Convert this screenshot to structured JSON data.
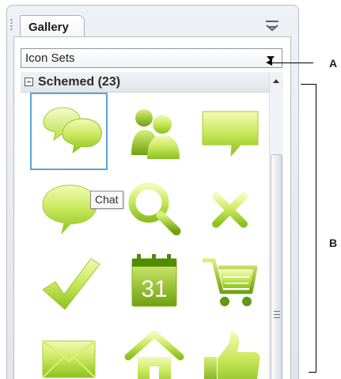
{
  "panel": {
    "tab_label": "Gallery",
    "menu_icon": "panel-menu-icon"
  },
  "dropdown": {
    "selected": "Icon Sets"
  },
  "group": {
    "title": "Schemed (23)",
    "collapse_icon": "collapse-minus-icon"
  },
  "gallery": {
    "items": [
      {
        "icon": "chat-icon",
        "selected": true
      },
      {
        "icon": "users-icon",
        "selected": false
      },
      {
        "icon": "speech-rectangle-icon",
        "selected": false
      },
      {
        "icon": "comment-bubble-icon",
        "selected": false
      },
      {
        "icon": "search-icon",
        "selected": false
      },
      {
        "icon": "close-x-icon",
        "selected": false
      },
      {
        "icon": "check-icon",
        "selected": false
      },
      {
        "icon": "calendar-icon",
        "calendar_day": "31",
        "selected": false
      },
      {
        "icon": "shopping-cart-icon",
        "selected": false
      },
      {
        "icon": "mail-icon",
        "selected": false
      },
      {
        "icon": "home-icon",
        "selected": false
      },
      {
        "icon": "thumbs-up-icon",
        "selected": false
      }
    ],
    "tooltip": "Chat"
  },
  "callouts": {
    "a": "A",
    "b": "B"
  },
  "colors": {
    "icon_green_light": "#eef8a4",
    "icon_green": "#b8df3a",
    "icon_green_dark": "#6ea10d",
    "selection_blue": "#5ba3d6"
  }
}
